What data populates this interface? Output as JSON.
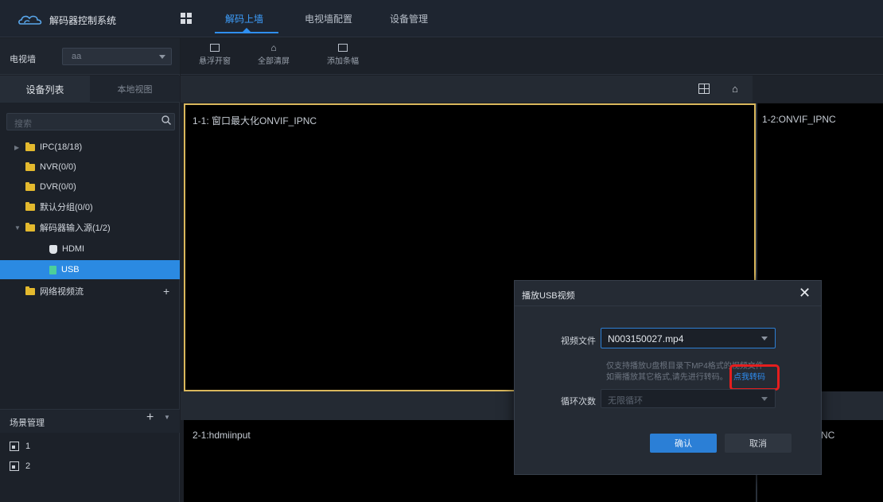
{
  "app": {
    "title": "解码器控制系统"
  },
  "nav": {
    "tabs": [
      {
        "label": "解码上墙"
      },
      {
        "label": "电视墙配置"
      },
      {
        "label": "设备管理"
      }
    ]
  },
  "left_panel": {
    "tvwall_label": "电视墙",
    "tvwall_value": "aa",
    "tabs": [
      {
        "label": "设备列表"
      },
      {
        "label": "本地视图"
      }
    ],
    "search_placeholder": "搜索",
    "tree": [
      {
        "label": "IPC(18/18)"
      },
      {
        "label": "NVR(0/0)"
      },
      {
        "label": "DVR(0/0)"
      },
      {
        "label": "默认分组(0/0)"
      },
      {
        "label": "解码器输入源(1/2)"
      },
      {
        "label": "HDMI"
      },
      {
        "label": "USB"
      },
      {
        "label": "网络视频流"
      }
    ],
    "scene": {
      "title": "场景管理",
      "items": [
        {
          "label": "1"
        },
        {
          "label": "2"
        }
      ]
    }
  },
  "toolbar": {
    "tools": [
      {
        "label": "悬浮开窗"
      },
      {
        "label": "全部清屏"
      },
      {
        "label": "添加条幅"
      }
    ]
  },
  "wall": {
    "windows": [
      {
        "label": "1-1:  窗口最大化ONVIF_IPNC"
      },
      {
        "label": "1-2:ONVIF_IPNC"
      },
      {
        "label": "2-1:hdmiinput"
      },
      {
        "label": "PNC"
      }
    ]
  },
  "modal": {
    "title": "播放USB视频",
    "video_file_label": "视频文件",
    "video_file_value": "N003150027.mp4",
    "hint_line1": "仅支持播放U盘根目录下MP4格式的视频文件",
    "hint_line2": "如需播放其它格式,请先进行转码。",
    "convert_link": "点我转码",
    "loop_label": "循环次数",
    "loop_value": "无限循环",
    "ok_label": "确认",
    "cancel_label": "取消"
  },
  "colors": {
    "accent": "#2b7fd6",
    "highlight": "#e51e1e",
    "selected_border": "#d9b75c"
  }
}
